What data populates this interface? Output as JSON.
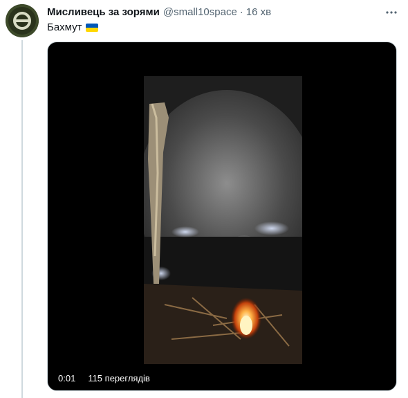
{
  "tweet": {
    "author_name": "Мисливець за зорями",
    "handle": "@small10space",
    "separator": "·",
    "time": "16 хв",
    "text": "Бахмут",
    "flag_icon": "ukraine-flag-icon",
    "more_icon": "more-options-icon"
  },
  "video": {
    "elapsed": "0:01",
    "views": "115 переглядів"
  },
  "colors": {
    "text_primary": "#0f1419",
    "text_secondary": "#536471",
    "thread_line": "#cfd9de",
    "media_background": "#000000"
  }
}
